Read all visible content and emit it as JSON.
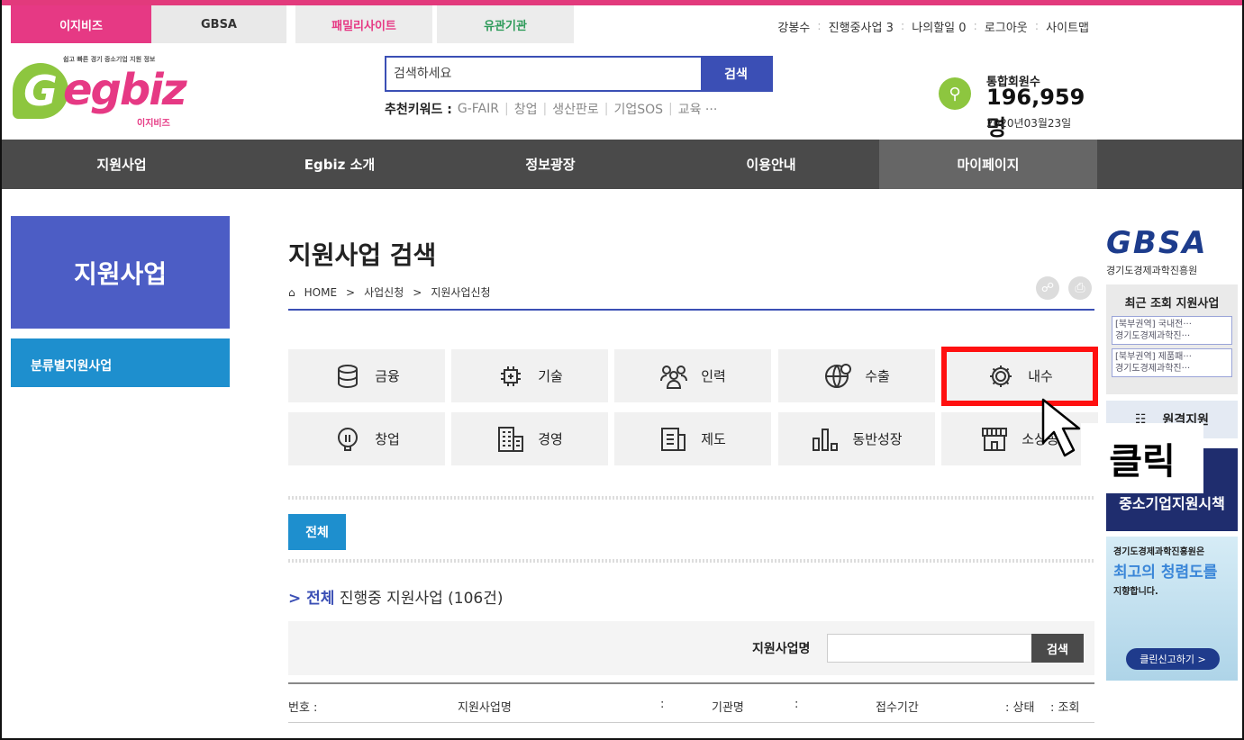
{
  "top_tabs": [
    "이지비즈",
    "GBSA",
    "패밀리사이트",
    "유관기관"
  ],
  "utility": [
    "강봉수",
    "진행중사업 3",
    "나의할일 0",
    "로그아웃",
    "사이트맵"
  ],
  "logo": {
    "slogan": "쉽고 빠른 경기 중소기업 지원 정보",
    "word": "egbiz",
    "g": "G",
    "sub": "이지비즈"
  },
  "search": {
    "placeholder": "검색하세요",
    "button": "검색"
  },
  "keywords": {
    "label": "추천키워드 :",
    "items": [
      "G-FAIR",
      "창업",
      "생산판로",
      "기업SOS",
      "교육 ···"
    ]
  },
  "members": {
    "label": "통합회원수",
    "count": "196,959명",
    "date": "2020년03월23일"
  },
  "nav": [
    "지원사업",
    "Egbiz 소개",
    "정보광장",
    "이용안내",
    "마이페이지"
  ],
  "left": {
    "title": "지원사업",
    "item": "분류별지원사업"
  },
  "main": {
    "title": "지원사업 검색",
    "crumbs": [
      "HOME",
      "사업신청",
      "지원사업신청"
    ],
    "categories": [
      "금융",
      "기술",
      "인력",
      "수출",
      "내수",
      "창업",
      "경영",
      "제도",
      "동반성장",
      "소상공"
    ],
    "all_button": "전체",
    "count_prefix": "전체",
    "count_text": "진행중 지원사업 (106건)",
    "search_label": "지원사업명",
    "search_button": "검색",
    "columns": [
      "번호 :",
      "지원사업명",
      ":",
      "기관명",
      ":",
      "접수기간",
      ": 상태",
      ": 조회"
    ]
  },
  "right": {
    "logo": "GBSA",
    "org": "경기도경제과학진흥원",
    "recent_title": "최근 조회 지원사업",
    "recent": [
      {
        "l1": "[북부권역] 국내전···",
        "l2": "경기도경제과학진···"
      },
      {
        "l1": "[북부권역] 제품패···",
        "l2": "경기도경제과학진···"
      }
    ],
    "remote": "원격지원",
    "banner1": "중소기업지원시책",
    "banner2_a": "경기도경제과학진흥원은",
    "banner2_b": "최고의 청렴도를",
    "banner2_c": "지향합니다.",
    "banner2_btn": "클린신고하기 >"
  },
  "annotation": {
    "label": "클릭",
    "color": "#ff1010"
  }
}
